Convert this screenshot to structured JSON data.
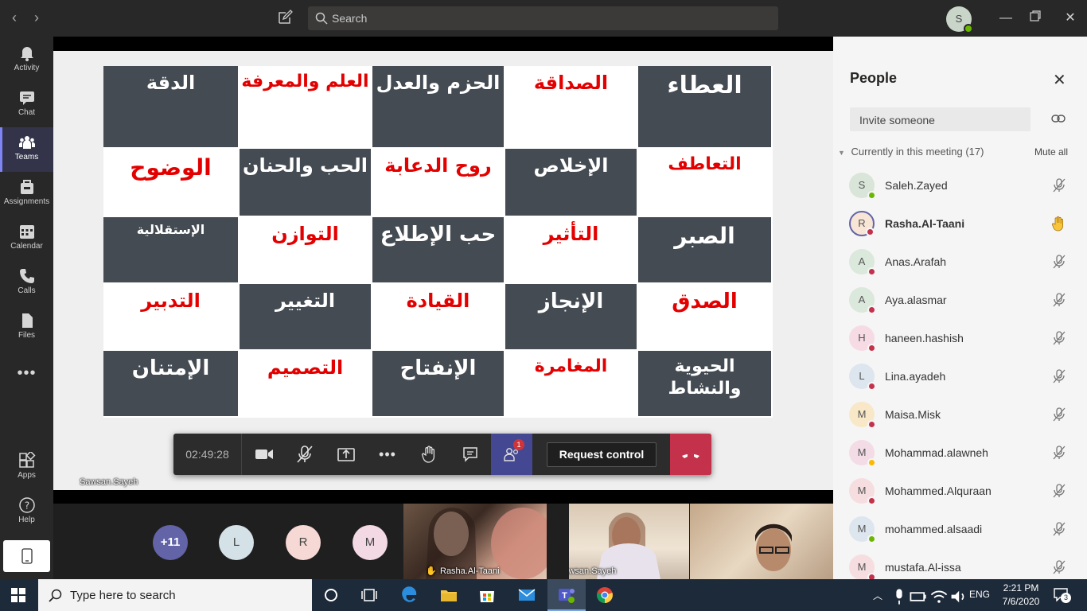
{
  "titlebar": {
    "search_placeholder": "Search",
    "user_initial": "S"
  },
  "rail": {
    "items": [
      {
        "label": "Activity",
        "icon": "bell-icon"
      },
      {
        "label": "Chat",
        "icon": "chat-icon"
      },
      {
        "label": "Teams",
        "icon": "teams-icon"
      },
      {
        "label": "Assignments",
        "icon": "assignments-icon"
      },
      {
        "label": "Calendar",
        "icon": "calendar-icon"
      },
      {
        "label": "Calls",
        "icon": "phone-icon"
      },
      {
        "label": "Files",
        "icon": "file-icon"
      },
      {
        "label": "Apps",
        "icon": "apps-icon"
      },
      {
        "label": "Help",
        "icon": "help-icon"
      }
    ]
  },
  "slide": {
    "cells": [
      [
        "الدقة",
        "العلم والمعرفة",
        "الحزم والعدل",
        "الصداقة",
        "العطاء"
      ],
      [
        "الوضوح",
        "الحب والحنان",
        "روح الدعابة",
        "الإخلاص",
        "التعاطف"
      ],
      [
        "الإستقلالية",
        "التوازن",
        "حب الإطلاع",
        "التأثير",
        "الصبر"
      ],
      [
        "التدبير",
        "التغيير",
        "القيادة",
        "الإنجاز",
        "الصدق"
      ],
      [
        "الإمتنان",
        "التصميم",
        "الإنفتاح",
        "المغامرة",
        "الحيوية والنشاط"
      ]
    ],
    "presenter_label": "Sawsan.Sayeh"
  },
  "callbar": {
    "timer": "02:49:28",
    "people_badge": "1",
    "request_control": "Request control"
  },
  "strip": {
    "overflow": "+11",
    "avatars": [
      "L",
      "R",
      "M"
    ],
    "videos": [
      {
        "name": "Rasha.Al-Taani",
        "hand": "✋"
      },
      {
        "name": "Sawsan.Sayeh"
      },
      {
        "name": ""
      }
    ]
  },
  "panel": {
    "title": "People",
    "invite_placeholder": "Invite someone",
    "section": "Currently in this meeting (17)",
    "mute_all": "Mute all",
    "participants": [
      {
        "initial": "S",
        "name": "Saleh.Zayed",
        "status": "available",
        "bold": false
      },
      {
        "initial": "R",
        "name": "Rasha.Al-Taani",
        "status": "busy",
        "bold": true,
        "hand": true
      },
      {
        "initial": "A",
        "name": "Anas.Arafah",
        "status": "busy",
        "bold": false
      },
      {
        "initial": "A",
        "name": "Aya.alasmar",
        "status": "busy",
        "bold": false
      },
      {
        "initial": "H",
        "name": "haneen.hashish",
        "status": "busy",
        "bold": false
      },
      {
        "initial": "L",
        "name": "Lina.ayadeh",
        "status": "busy",
        "bold": false
      },
      {
        "initial": "M",
        "name": "Maisa.Misk",
        "status": "busy",
        "bold": false
      },
      {
        "initial": "M",
        "name": "Mohammad.alawneh",
        "status": "away",
        "bold": false
      },
      {
        "initial": "M",
        "name": "Mohammed.Alquraan",
        "status": "busy",
        "bold": false
      },
      {
        "initial": "M",
        "name": "mohammed.alsaadi",
        "status": "available",
        "bold": false
      },
      {
        "initial": "M",
        "name": "mustafa.Al-issa",
        "status": "busy",
        "bold": false
      }
    ]
  },
  "taskbar": {
    "search_placeholder": "Type here to search",
    "language": "ENG",
    "time": "2:21 PM",
    "date": "7/6/2020",
    "notifications": "3"
  },
  "colors": {
    "dark_cell": "#444b52",
    "red_text": "#e30000",
    "teams_accent": "#444791",
    "hangup": "#c4314b"
  }
}
